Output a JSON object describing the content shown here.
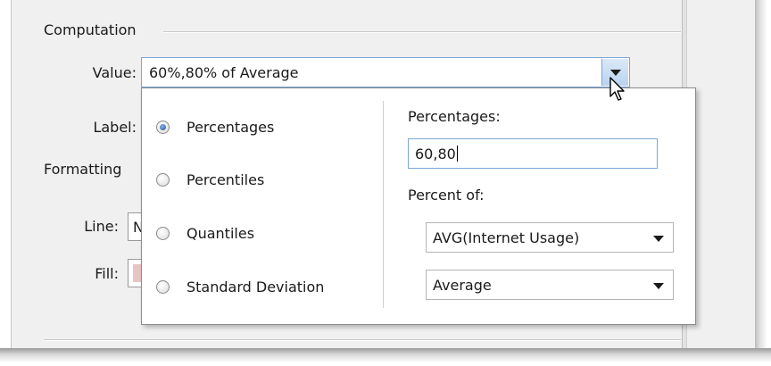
{
  "computation": {
    "section_title": "Computation",
    "value_label": "Value:",
    "value_text": "60%,80% of Average",
    "label_label": "Label:",
    "line_label": "Line:",
    "line_value_fragment": "N",
    "fill_label": "Fill:"
  },
  "formatting": {
    "section_title": "Formatting"
  },
  "popup": {
    "radio_options": [
      {
        "label": "Percentages",
        "selected": true
      },
      {
        "label": "Percentiles",
        "selected": false
      },
      {
        "label": "Quantiles",
        "selected": false
      },
      {
        "label": "Standard Deviation",
        "selected": false
      }
    ],
    "percentages_label": "Percentages:",
    "percentages_value": "60,80",
    "percent_of_label": "Percent of:",
    "measure_select": "AVG(Internet Usage)",
    "aggregation_select": "Average"
  },
  "colors": {
    "dialog_bg": "#f0f0f0",
    "focus_border": "#7aa7d8",
    "radio_dot": "#1f4f99",
    "fill_swatch": "#e8c4c4"
  },
  "icons": {
    "combo_arrow": "chevron-down-icon",
    "cursor": "mouse-pointer-icon"
  }
}
